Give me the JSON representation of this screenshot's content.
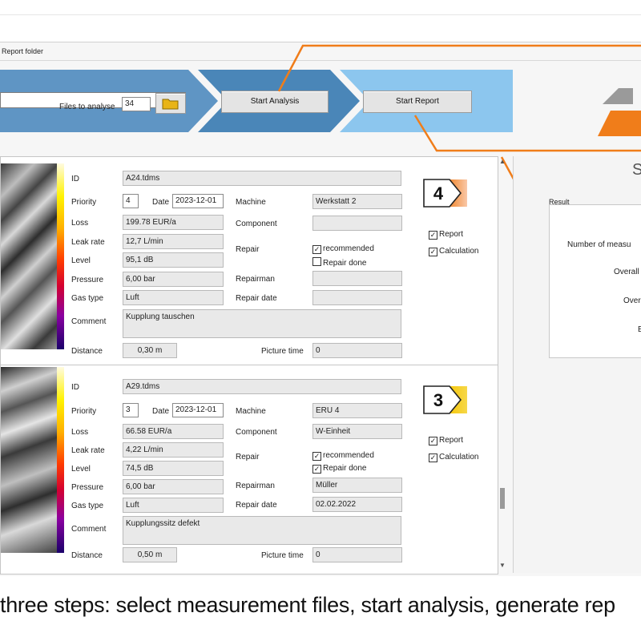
{
  "window": {
    "title": "Report folder"
  },
  "workflow": {
    "files_label": "Files to analyse",
    "files_value": "34",
    "start_analysis": "Start Analysis",
    "start_report": "Start Report",
    "colors": {
      "step1": "#5f95c4",
      "step2": "#4a86b8",
      "step3": "#8cc6ee",
      "accent": "#f07d1a"
    }
  },
  "labels": {
    "id": "ID",
    "priority": "Priority",
    "date": "Date",
    "loss": "Loss",
    "leak_rate": "Leak rate",
    "level": "Level",
    "pressure": "Pressure",
    "gas_type": "Gas type",
    "comment": "Comment",
    "distance": "Distance",
    "machine": "Machine",
    "component": "Component",
    "repair": "Repair",
    "repairman": "Repairman",
    "repair_date": "Repair date",
    "picture_time": "Picture time",
    "recommended": "recommended",
    "repair_done": "Repair done",
    "report": "Report",
    "calculation": "Calculation"
  },
  "records": [
    {
      "id": "A24.tdms",
      "priority": "4",
      "date": "2023-12-01",
      "loss": "199.78 EUR/a",
      "leak_rate": "12,7 L/min",
      "level": "95,1 dB",
      "pressure": "6,00 bar",
      "gas_type": "Luft",
      "comment": "Kupplung tauschen",
      "distance": "0,30 m",
      "machine": "Werkstatt 2",
      "component": "",
      "repair_recommended": true,
      "repair_done": false,
      "repairman": "",
      "repair_date": "",
      "picture_time": "0",
      "report": true,
      "calculation": true,
      "badge": "4",
      "badge_color": "#f07d1a"
    },
    {
      "id": "A29.tdms",
      "priority": "3",
      "date": "2023-12-01",
      "loss": "66.58 EUR/a",
      "leak_rate": "4,22 L/min",
      "level": "74,5 dB",
      "pressure": "6,00 bar",
      "gas_type": "Luft",
      "comment": "Kupplungssitz defekt",
      "distance": "0,50 m",
      "machine": "ERU 4",
      "component": "W-Einheit",
      "repair_recommended": true,
      "repair_done": true,
      "repairman": "Müller",
      "repair_date": "02.02.2022",
      "picture_time": "0",
      "report": true,
      "calculation": true,
      "badge": "3",
      "badge_color": "#f5c400"
    }
  ],
  "result": {
    "title": "S",
    "group_label": "Result",
    "lines": [
      "Number of measu",
      "Overall",
      "Over",
      "E"
    ]
  },
  "caption": "three steps: select measurement files, start analysis, generate rep"
}
